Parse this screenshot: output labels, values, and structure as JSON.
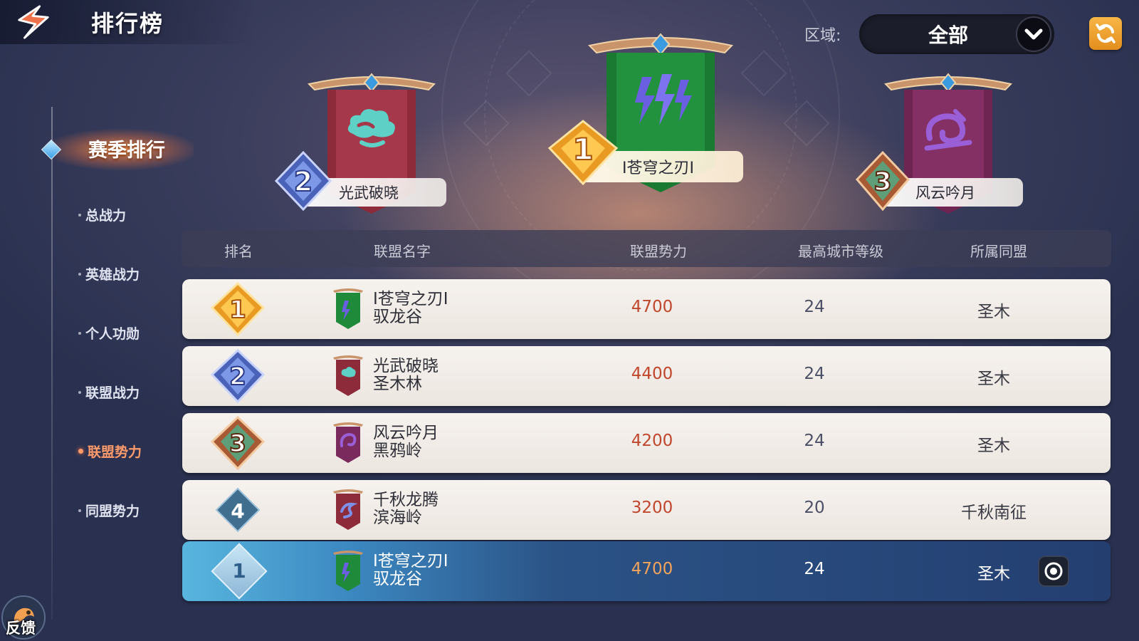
{
  "header": {
    "title": "排行榜"
  },
  "region": {
    "label": "区域:",
    "value": "全部"
  },
  "sidebar": {
    "season_tab": "赛季排行",
    "items": [
      {
        "label": "总战力",
        "active": false
      },
      {
        "label": "英雄战力",
        "active": false
      },
      {
        "label": "个人功勋",
        "active": false
      },
      {
        "label": "联盟战力",
        "active": false
      },
      {
        "label": "联盟势力",
        "active": true
      },
      {
        "label": "同盟势力",
        "active": false
      }
    ]
  },
  "podium": {
    "first": {
      "rank": "1",
      "name": "I苍穹之刃I",
      "banner_color": "#1f8a3a",
      "emblem": "lightning-emblem"
    },
    "second": {
      "rank": "2",
      "name": "光武破晓",
      "banner_color": "#8e2b3a",
      "emblem": "cloud-emblem"
    },
    "third": {
      "rank": "3",
      "name": "风云吟月",
      "banner_color": "#7a2a5c",
      "emblem": "swirl-emblem"
    }
  },
  "table": {
    "headers": [
      "排名",
      "联盟名字",
      "联盟势力",
      "最高城市等级",
      "所属同盟"
    ],
    "rows": [
      {
        "rank": "1",
        "name": "I苍穹之刃I",
        "region": "驭龙谷",
        "power": "4700",
        "city_level": "24",
        "alliance": "圣木",
        "banner_color": "#1f8a3a"
      },
      {
        "rank": "2",
        "name": "光武破晓",
        "region": "圣木林",
        "power": "4400",
        "city_level": "24",
        "alliance": "圣木",
        "banner_color": "#8e2b3a"
      },
      {
        "rank": "3",
        "name": "风云吟月",
        "region": "黑鸦岭",
        "power": "4200",
        "city_level": "24",
        "alliance": "圣木",
        "banner_color": "#7a2a5c"
      },
      {
        "rank": "4",
        "name": "千秋龙腾",
        "region": "滨海岭",
        "power": "3200",
        "city_level": "20",
        "alliance": "千秋南征",
        "banner_color": "#8e2b3a"
      }
    ],
    "my_row": {
      "rank": "1",
      "name": "I苍穹之刃I",
      "region": "驭龙谷",
      "power": "4700",
      "city_level": "24",
      "alliance": "圣木",
      "banner_color": "#1f8a3a"
    }
  },
  "feedback": {
    "label": "反馈"
  },
  "colors": {
    "accent": "#ff9a6a",
    "power_text": "#c0462c",
    "gold": "#f2b845",
    "silver_blue": "#5a79c8",
    "bronze": "#b5663c"
  }
}
